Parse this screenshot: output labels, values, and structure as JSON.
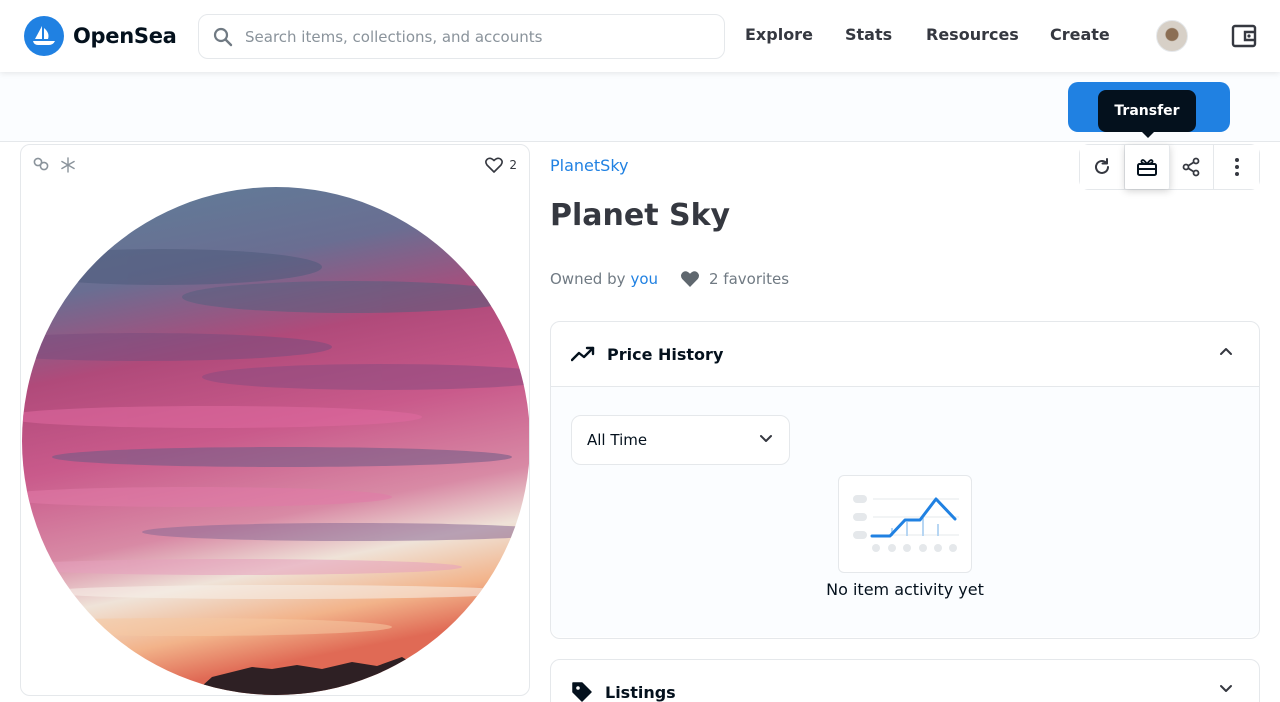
{
  "header": {
    "logo_text": "OpenSea",
    "search_placeholder": "Search items, collections, and accounts",
    "nav": [
      "Explore",
      "Stats",
      "Resources",
      "Create"
    ]
  },
  "tooltip": {
    "label": "Transfer"
  },
  "media": {
    "favorites_count": "2"
  },
  "item": {
    "collection": "PlanetSky",
    "title": "Planet Sky",
    "owned_by_label": "Owned by",
    "owner": "you",
    "favorites": "2 favorites"
  },
  "price_history": {
    "title": "Price History",
    "selected_range": "All Time",
    "empty_text": "No item activity yet"
  },
  "listings": {
    "title": "Listings"
  },
  "colors": {
    "accent": "#2081e2",
    "text": "#04111d",
    "muted": "#707a83"
  }
}
